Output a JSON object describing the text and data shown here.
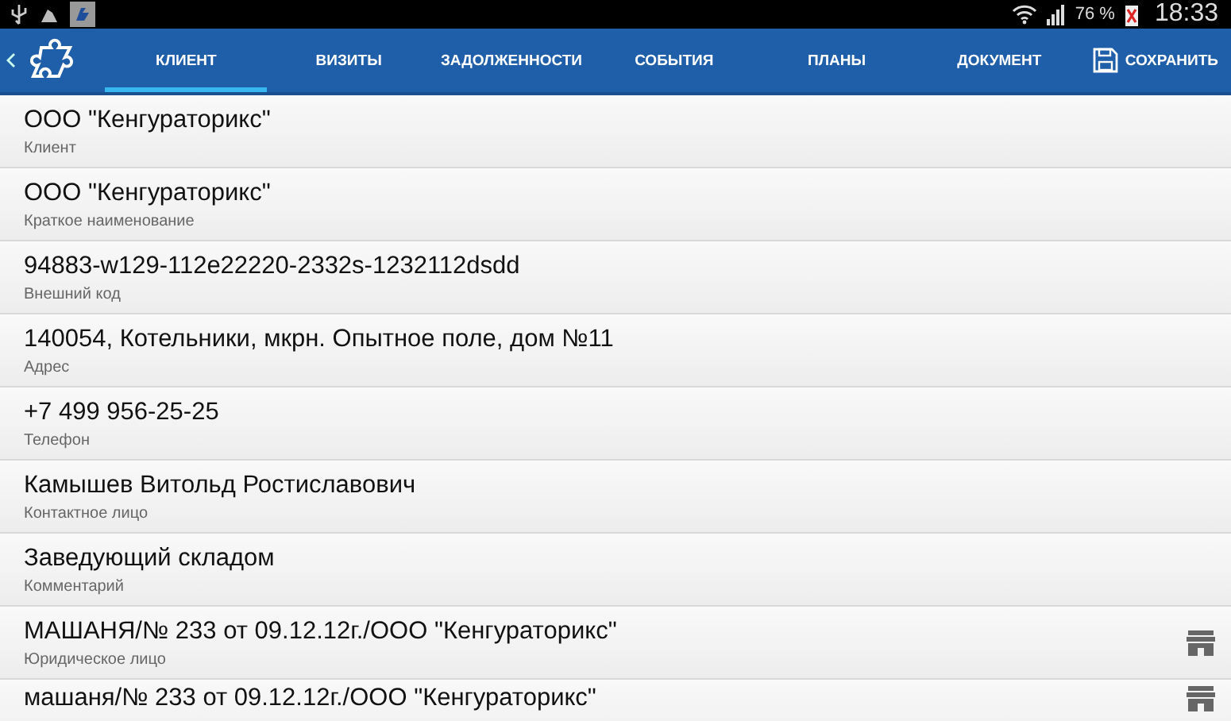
{
  "status_bar": {
    "battery_percent": "76 %",
    "time": "18:33"
  },
  "tabs": [
    {
      "label": "КЛИЕНТ",
      "selected": true
    },
    {
      "label": "ВИЗИТЫ",
      "selected": false
    },
    {
      "label": "ЗАДОЛЖЕННОСТИ",
      "selected": false
    },
    {
      "label": "СОБЫТИЯ",
      "selected": false
    },
    {
      "label": "ПЛАНЫ",
      "selected": false
    },
    {
      "label": "ДОКУМЕНТ",
      "selected": false
    }
  ],
  "save_button": {
    "label": "СОХРАНИТЬ"
  },
  "fields": [
    {
      "kind": "text",
      "value": "ООО \"Кенгураторикс\"",
      "label": "Клиент"
    },
    {
      "kind": "text",
      "value": "ООО \"Кенгураторикс\"",
      "label": "Краткое наименование"
    },
    {
      "kind": "text",
      "value": "94883-w129-112e22220-2332s-1232112dsdd",
      "label": "Внешний код"
    },
    {
      "kind": "text",
      "value": "140054, Котельники, мкрн. Опытное поле, дом №11",
      "label": "Адрес"
    },
    {
      "kind": "text",
      "value": "+7 499 956-25-25",
      "label": "Телефон"
    },
    {
      "kind": "text",
      "value": "Камышев Витольд Ростиславович",
      "label": "Контактное лицо"
    },
    {
      "kind": "text",
      "value": "Заведующий складом",
      "label": "Комментарий"
    },
    {
      "kind": "link",
      "value": "МАШАНЯ/№ 233 от 09.12.12г./ООО \"Кенгураторикс\"",
      "label": "Юридическое лицо"
    },
    {
      "kind": "link",
      "value": "машаня/№ 233 от 09.12.12г./ООО \"Кенгураторикс\""
    }
  ]
}
